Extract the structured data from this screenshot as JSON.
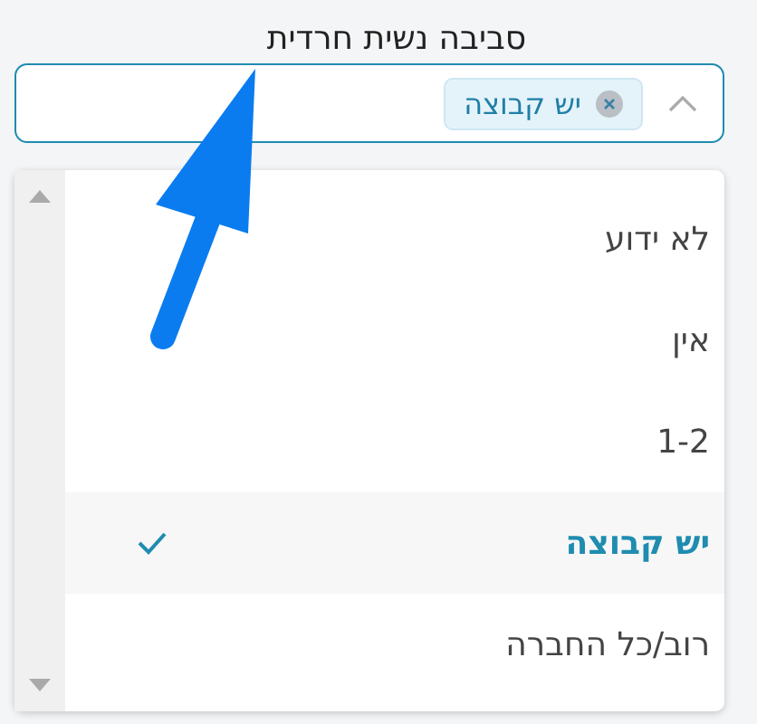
{
  "field": {
    "label": "סביבה נשית חרדית",
    "chips": [
      {
        "label": "יש קבוצה"
      }
    ]
  },
  "dropdown": {
    "options": [
      {
        "label": "לא ידוע",
        "selected": false
      },
      {
        "label": "אין",
        "selected": false
      },
      {
        "label": "1-2",
        "selected": false
      },
      {
        "label": "יש קבוצה",
        "selected": true
      },
      {
        "label": "רוב/כל החברה",
        "selected": false
      }
    ]
  }
}
